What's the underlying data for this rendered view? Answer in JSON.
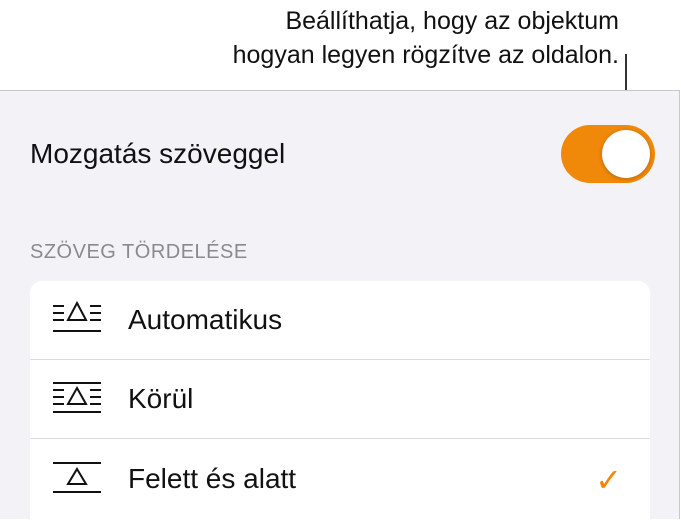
{
  "callout": {
    "line1": "Beállíthatja, hogy az objektum",
    "line2": "hogyan legyen rögzítve az oldalon."
  },
  "settings": {
    "move_with_text_label": "Mozgatás szöveggel",
    "move_with_text_on": true,
    "accent_color": "#f0890a"
  },
  "text_wrap": {
    "section_title": "SZÖVEG TÖRDELÉSE",
    "options": [
      {
        "label": "Automatikus",
        "icon": "wrap-automatic-icon",
        "selected": false
      },
      {
        "label": "Körül",
        "icon": "wrap-around-icon",
        "selected": false
      },
      {
        "label": "Felett és alatt",
        "icon": "wrap-above-below-icon",
        "selected": true
      }
    ],
    "check_glyph": "✓"
  }
}
